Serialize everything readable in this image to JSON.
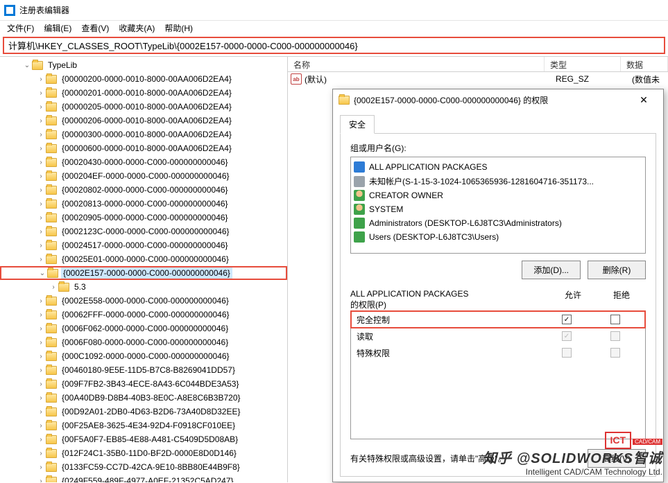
{
  "window": {
    "title": "注册表编辑器"
  },
  "menu": {
    "file": "文件(F)",
    "edit": "编辑(E)",
    "view": "查看(V)",
    "fav": "收藏夹(A)",
    "help": "帮助(H)"
  },
  "address": "计算机\\HKEY_CLASSES_ROOT\\TypeLib\\{0002E157-0000-0000-C000-000000000046}",
  "tree": {
    "root": "TypeLib",
    "selected": "{0002E157-0000-0000-C000-000000000046}",
    "child": "5.3",
    "items": [
      "{00000200-0000-0010-8000-00AA006D2EA4}",
      "{00000201-0000-0010-8000-00AA006D2EA4}",
      "{00000205-0000-0010-8000-00AA006D2EA4}",
      "{00000206-0000-0010-8000-00AA006D2EA4}",
      "{00000300-0000-0010-8000-00AA006D2EA4}",
      "{00000600-0000-0010-8000-00AA006D2EA4}",
      "{00020430-0000-0000-C000-000000000046}",
      "{000204EF-0000-0000-C000-000000000046}",
      "{00020802-0000-0000-C000-000000000046}",
      "{00020813-0000-0000-C000-000000000046}",
      "{00020905-0000-0000-C000-000000000046}",
      "{0002123C-0000-0000-C000-000000000046}",
      "{00024517-0000-0000-C000-000000000046}",
      "{00025E01-0000-0000-C000-000000000046}"
    ],
    "items_after": [
      "{0002E558-0000-0000-C000-000000000046}",
      "{00062FFF-0000-0000-C000-000000000046}",
      "{0006F062-0000-0000-C000-000000000046}",
      "{0006F080-0000-0000-C000-000000000046}",
      "{000C1092-0000-0000-C000-000000000046}",
      "{00460180-9E5E-11D5-B7C8-B8269041DD57}",
      "{009F7FB2-3B43-4ECE-8A43-6C044BDE3A53}",
      "{00A40DB9-D8B4-40B3-8E0C-A8E8C6B3B720}",
      "{00D92A01-2DB0-4D63-B2D6-73A40D8D32EE}",
      "{00F25AE8-3625-4E34-92D4-F0918CF010EE}",
      "{00F5A0F7-EB85-4E88-A481-C5409D5D08AB}",
      "{012F24C1-35B0-11D0-BF2D-0000E8D0D146}",
      "{0133FC59-CC7D-42CA-9E10-8BB80E44B9F8}",
      "{0249F559-489F-4977-A0EF-21352C5AD247}"
    ]
  },
  "list": {
    "cols": {
      "name": "名称",
      "type": "类型",
      "data": "数据"
    },
    "row": {
      "name": "(默认)",
      "type": "REG_SZ",
      "data": "(数值未"
    },
    "ab": "ab"
  },
  "dialog": {
    "title": "{0002E157-0000-0000-C000-000000000046} 的权限",
    "tab": "安全",
    "groups_label": "组或用户名(G):",
    "users": [
      {
        "icon": "u-blue",
        "label": "ALL APPLICATION PACKAGES"
      },
      {
        "icon": "u-grey",
        "label": "未知帐户(S-1-15-3-1024-1065365936-1281604716-351173..."
      },
      {
        "icon": "u-ghead",
        "label": "CREATOR OWNER"
      },
      {
        "icon": "u-ghead",
        "label": "SYSTEM"
      },
      {
        "icon": "u-green",
        "label": "Administrators (DESKTOP-L6J8TC3\\Administrators)"
      },
      {
        "icon": "u-green",
        "label": "Users (DESKTOP-L6J8TC3\\Users)"
      }
    ],
    "add": "添加(D)...",
    "remove": "删除(R)",
    "perm_for": "ALL APPLICATION PACKAGES",
    "perm_for2": "的权限(P)",
    "allow": "允许",
    "deny": "拒绝",
    "perms": [
      {
        "name": "完全控制",
        "allow": true,
        "deny": false,
        "hl": true,
        "disabled": false
      },
      {
        "name": "读取",
        "allow": true,
        "deny": false,
        "hl": false,
        "disabled": true
      },
      {
        "name": "特殊权限",
        "allow": false,
        "deny": false,
        "hl": false,
        "disabled": true
      }
    ],
    "adv_text": "有关特殊权限或高级设置，请单击\"高级\"。",
    "adv_btn": "高级(V)"
  },
  "watermark": {
    "ict": "ICT",
    "cadcam": "CAD/CAM",
    "line1": "知乎 @SOLIDWORKS智诚",
    "line2": "Intelligent CAD/CAM Technology Ltd."
  }
}
